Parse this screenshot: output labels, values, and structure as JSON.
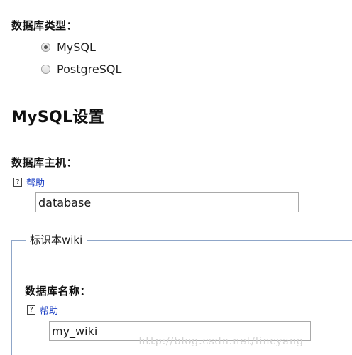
{
  "db_type": {
    "label": "数据库类型：",
    "options": [
      {
        "label": "MySQL",
        "selected": true
      },
      {
        "label": "PostgreSQL",
        "selected": false
      }
    ]
  },
  "mysql_section": {
    "title": "MySQL设置"
  },
  "db_host": {
    "label": "数据库主机：",
    "help_icon": "?",
    "help_text": "帮助",
    "value": "database"
  },
  "fieldset": {
    "legend": "标识本wiki",
    "db_name": {
      "label": "数据库名称：",
      "help_icon": "?",
      "help_text": "帮助",
      "value": "my_wiki"
    }
  },
  "watermark": "http://blog.csdn.net/lincyang",
  "colors": {
    "link": "#1b3fc4",
    "fieldset_border": "#8fa6c8"
  }
}
